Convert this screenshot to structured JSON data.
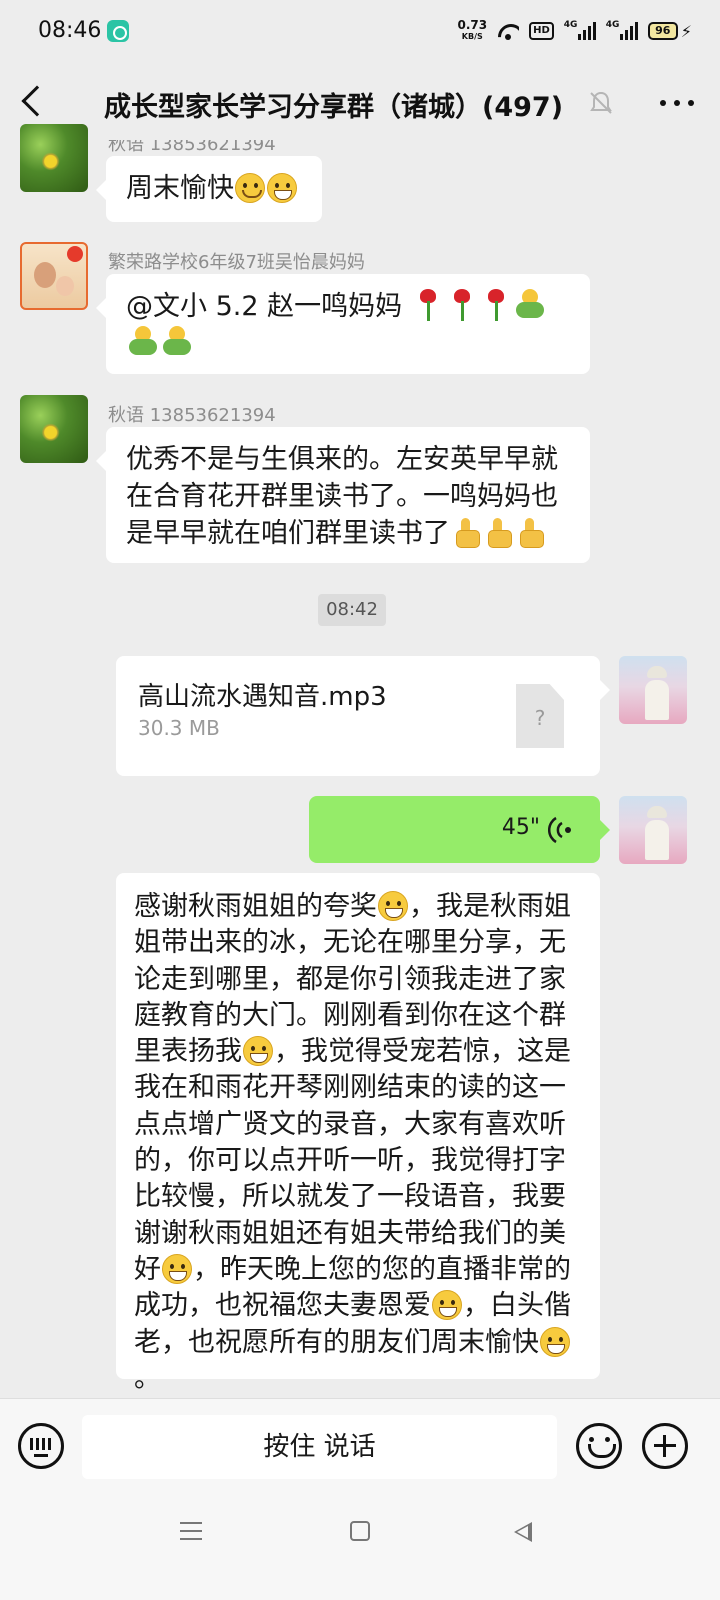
{
  "status_bar": {
    "time": "08:46",
    "net_speed_value": "0.73",
    "net_speed_unit": "KB/S",
    "hd_label": "HD",
    "signal1_label": "4G",
    "signal2_label": "4G",
    "battery_level": "96"
  },
  "nav": {
    "title": "成长型家长学习分享群（诸城）(497)"
  },
  "messages": {
    "m1": {
      "sender": "秋语 13853621394",
      "text": "周末愉快"
    },
    "m2": {
      "sender": "繁荣路学校6年级7班吴怡晨妈妈",
      "text": "@文小 5.2 赵一鸣妈妈"
    },
    "m3": {
      "sender": "秋语 13853621394",
      "text": "优秀不是与生俱来的。左安英早早就在合育花开群里读书了。一鸣妈妈也是早早就在咱们群里读书了"
    },
    "timestamp": "08:42",
    "file": {
      "name": "高山流水遇知音.mp3",
      "size": "30.3 MB",
      "placeholder_glyph": "?"
    },
    "voice": {
      "duration": "45\""
    },
    "long": {
      "p1": "感谢秋雨姐姐的夸奖",
      "p2": "，我是秋雨姐姐带出来的冰，无论在哪里分享，无论走到哪里，都是你引领我走进了家庭教育的大门。刚刚看到你在这个群里表扬我",
      "p3": "，我觉得受宠若惊，这是我在和雨花开琴刚刚结束的读的这一点点增广贤文的录音，大家有喜欢听的，你可以点开听一听，我觉得打字比较慢，所以就发了一段语音，我要谢谢秋雨姐姐还有姐夫带给我们的美好",
      "p4": "，昨天晚上您的您的直播非常的成功，也祝福您夫妻恩爱",
      "p5": "，白头偕老，也祝愿所有的朋友们周末愉快",
      "p6": "。"
    }
  },
  "input_bar": {
    "hold_to_talk": "按住 说话"
  },
  "icons": {
    "back": "back-arrow-icon",
    "mute": "bell-mute-icon",
    "more": "more-dots-icon",
    "keyboard": "keyboard-icon",
    "emoji": "emoji-icon",
    "plus": "plus-icon",
    "file": "unknown-file-icon",
    "voice": "voice-wave-icon"
  },
  "colors": {
    "background": "#ededed",
    "bubble_in": "#ffffff",
    "voice_bubble": "#95ec69",
    "sender_text": "#8d8d8d"
  }
}
